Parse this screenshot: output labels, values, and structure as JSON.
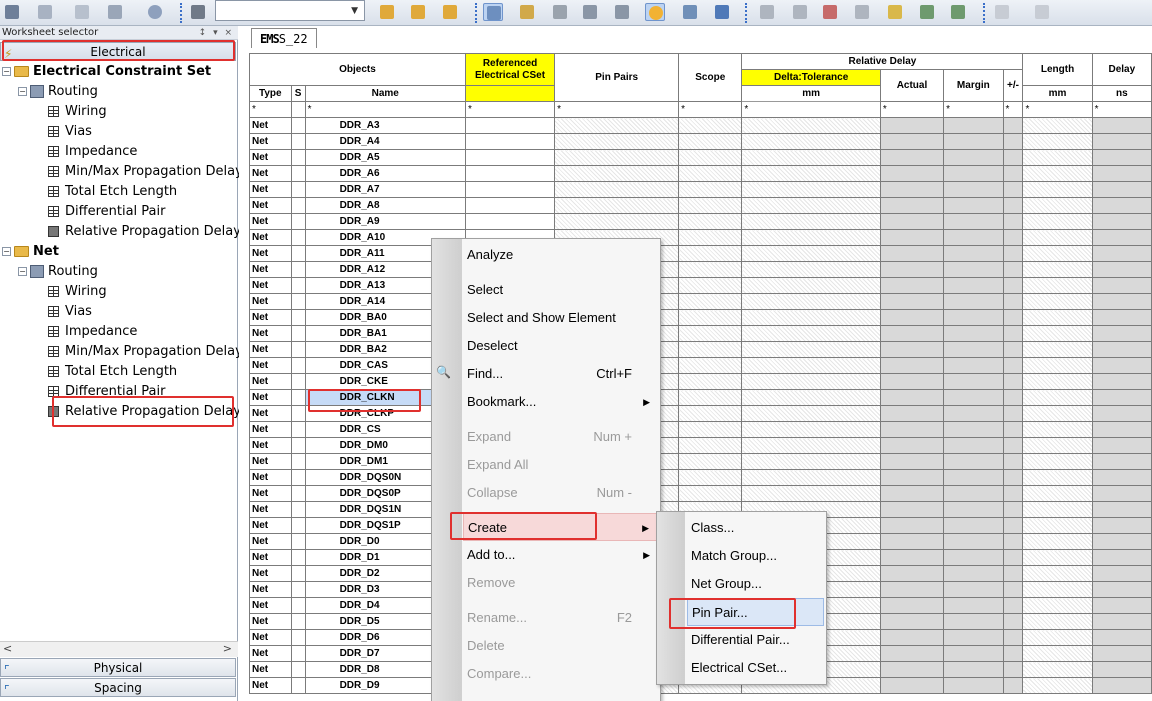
{
  "toolbar": {
    "combo_value": ""
  },
  "left_panel": {
    "header": "Worksheet selector",
    "header_pins": "↕ ▾ ×",
    "tab_top": "Electrical",
    "tree": [
      {
        "label": "Electrical Constraint Set",
        "bold": true,
        "level": 0,
        "icon": "folder"
      },
      {
        "label": "Routing",
        "bold": false,
        "level": 1,
        "icon": "routing"
      },
      {
        "label": "Wiring",
        "bold": false,
        "level": 2,
        "icon": "grid"
      },
      {
        "label": "Vias",
        "bold": false,
        "level": 2,
        "icon": "grid"
      },
      {
        "label": "Impedance",
        "bold": false,
        "level": 2,
        "icon": "grid"
      },
      {
        "label": "Min/Max Propagation Delay",
        "bold": false,
        "level": 2,
        "icon": "grid"
      },
      {
        "label": "Total Etch Length",
        "bold": false,
        "level": 2,
        "icon": "grid"
      },
      {
        "label": "Differential Pair",
        "bold": false,
        "level": 2,
        "icon": "grid"
      },
      {
        "label": "Relative Propagation Delay",
        "bold": false,
        "level": 2,
        "icon": "grid-alt"
      },
      {
        "label": "Net",
        "bold": true,
        "level": 0,
        "icon": "folder"
      },
      {
        "label": "Routing",
        "bold": false,
        "level": 1,
        "icon": "routing"
      },
      {
        "label": "Wiring",
        "bold": false,
        "level": 2,
        "icon": "grid"
      },
      {
        "label": "Vias",
        "bold": false,
        "level": 2,
        "icon": "grid"
      },
      {
        "label": "Impedance",
        "bold": false,
        "level": 2,
        "icon": "grid"
      },
      {
        "label": "Min/Max Propagation Delay",
        "bold": false,
        "level": 2,
        "icon": "grid"
      },
      {
        "label": "Total Etch Length",
        "bold": false,
        "level": 2,
        "icon": "grid"
      },
      {
        "label": "Differential Pair",
        "bold": false,
        "level": 2,
        "icon": "grid"
      },
      {
        "label": "Relative Propagation Delay",
        "bold": false,
        "level": 2,
        "icon": "grid-alt"
      }
    ],
    "scroll_left": "<",
    "scroll_right": ">",
    "tab_physical": "Physical",
    "tab_spacing": "Spacing"
  },
  "worksheet": {
    "tab_tag": "EMS",
    "tab_label": "S_22",
    "headers": {
      "objects": "Objects",
      "referenced": "Referenced Electrical CSet",
      "pin_pairs": "Pin Pairs",
      "scope": "Scope",
      "relative_delay": "Relative Delay",
      "delta_tolerance": "Delta:Tolerance",
      "actual": "Actual",
      "margin": "Margin",
      "plus_minus": "+/-",
      "length": "Length",
      "delay": "Delay",
      "type": "Type",
      "s": "S",
      "name": "Name",
      "unit_mm": "mm",
      "unit_mm2": "mm",
      "unit_ns": "ns",
      "filter": "*"
    },
    "rows": [
      {
        "type": "Net",
        "name": "DDR_A3"
      },
      {
        "type": "Net",
        "name": "DDR_A4"
      },
      {
        "type": "Net",
        "name": "DDR_A5"
      },
      {
        "type": "Net",
        "name": "DDR_A6"
      },
      {
        "type": "Net",
        "name": "DDR_A7"
      },
      {
        "type": "Net",
        "name": "DDR_A8"
      },
      {
        "type": "Net",
        "name": "DDR_A9"
      },
      {
        "type": "Net",
        "name": "DDR_A10"
      },
      {
        "type": "Net",
        "name": "DDR_A11"
      },
      {
        "type": "Net",
        "name": "DDR_A12"
      },
      {
        "type": "Net",
        "name": "DDR_A13"
      },
      {
        "type": "Net",
        "name": "DDR_A14"
      },
      {
        "type": "Net",
        "name": "DDR_BA0"
      },
      {
        "type": "Net",
        "name": "DDR_BA1"
      },
      {
        "type": "Net",
        "name": "DDR_BA2"
      },
      {
        "type": "Net",
        "name": "DDR_CAS"
      },
      {
        "type": "Net",
        "name": "DDR_CKE"
      },
      {
        "type": "Net",
        "name": "DDR_CLKN"
      },
      {
        "type": "Net",
        "name": "DDR_CLKP"
      },
      {
        "type": "Net",
        "name": "DDR_CS"
      },
      {
        "type": "Net",
        "name": "DDR_DM0"
      },
      {
        "type": "Net",
        "name": "DDR_DM1"
      },
      {
        "type": "Net",
        "name": "DDR_DQS0N"
      },
      {
        "type": "Net",
        "name": "DDR_DQS0P"
      },
      {
        "type": "Net",
        "name": "DDR_DQS1N"
      },
      {
        "type": "Net",
        "name": "DDR_DQS1P"
      },
      {
        "type": "Net",
        "name": "DDR_D0"
      },
      {
        "type": "Net",
        "name": "DDR_D1"
      },
      {
        "type": "Net",
        "name": "DDR_D2"
      },
      {
        "type": "Net",
        "name": "DDR_D3"
      },
      {
        "type": "Net",
        "name": "DDR_D4"
      },
      {
        "type": "Net",
        "name": "DDR_D5"
      },
      {
        "type": "Net",
        "name": "DDR_D6"
      },
      {
        "type": "Net",
        "name": "DDR_D7"
      },
      {
        "type": "Net",
        "name": "DDR_D8"
      },
      {
        "type": "Net",
        "name": "DDR_D9"
      }
    ],
    "selected_row": "DDR_CLKN"
  },
  "context_menu": {
    "items": [
      {
        "label": "Analyze",
        "shortcut": "",
        "submenu": false,
        "disabled": false
      },
      {
        "label": "Select",
        "shortcut": "",
        "submenu": false,
        "disabled": false
      },
      {
        "label": "Select and Show Element",
        "shortcut": "",
        "submenu": false,
        "disabled": false
      },
      {
        "label": "Deselect",
        "shortcut": "",
        "submenu": false,
        "disabled": false
      },
      {
        "label": "Find...",
        "shortcut": "Ctrl+F",
        "submenu": false,
        "disabled": false
      },
      {
        "label": "Bookmark...",
        "shortcut": "",
        "submenu": true,
        "disabled": false
      },
      {
        "label": "Expand",
        "shortcut": "Num +",
        "submenu": false,
        "disabled": true
      },
      {
        "label": "Expand All",
        "shortcut": "",
        "submenu": false,
        "disabled": true
      },
      {
        "label": "Collapse",
        "shortcut": "Num -",
        "submenu": false,
        "disabled": true
      },
      {
        "label": "Create",
        "shortcut": "",
        "submenu": true,
        "disabled": false
      },
      {
        "label": "Add to...",
        "shortcut": "",
        "submenu": true,
        "disabled": false
      },
      {
        "label": "Remove",
        "shortcut": "",
        "submenu": false,
        "disabled": true
      },
      {
        "label": "Rename...",
        "shortcut": "F2",
        "submenu": false,
        "disabled": true
      },
      {
        "label": "Delete",
        "shortcut": "",
        "submenu": false,
        "disabled": true
      },
      {
        "label": "Compare...",
        "shortcut": "",
        "submenu": false,
        "disabled": true
      }
    ]
  },
  "create_submenu": {
    "items": [
      {
        "label": "Class..."
      },
      {
        "label": "Match Group..."
      },
      {
        "label": "Net Group..."
      },
      {
        "label": "Pin Pair..."
      },
      {
        "label": "Differential Pair..."
      },
      {
        "label": "Electrical CSet..."
      }
    ]
  },
  "colors": {
    "highlight_red": "#e0302e",
    "header_yellow": "#ffff00",
    "selection_blue": "#c6dbf7"
  }
}
